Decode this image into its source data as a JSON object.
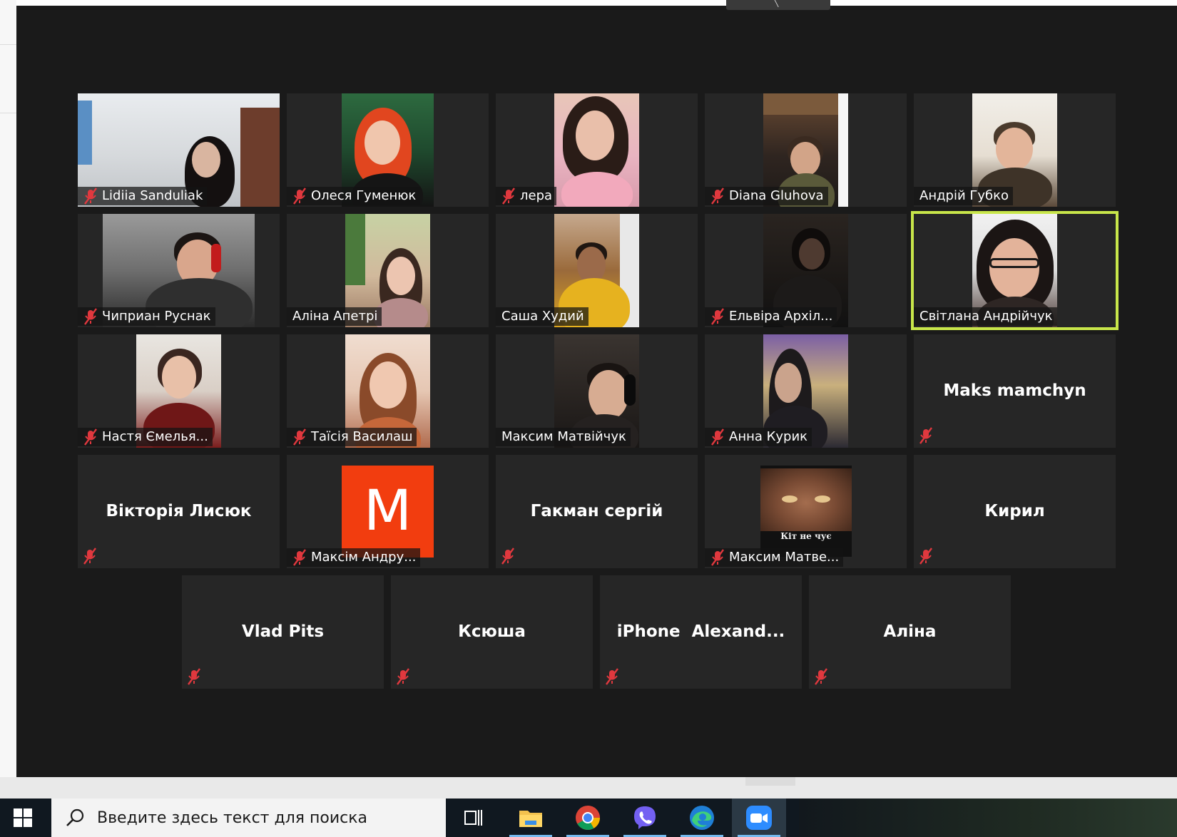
{
  "meeting": {
    "participants": [
      {
        "name": "Lidiia Sanduliak",
        "muted": true
      },
      {
        "name": "Олеся Гуменюк",
        "muted": true
      },
      {
        "name": "лера",
        "muted": true
      },
      {
        "name": "Diana Gluhova",
        "muted": true
      },
      {
        "name": "Андрій Губко",
        "muted": false
      },
      {
        "name": "Чиприан Руснак",
        "muted": true
      },
      {
        "name": "Аліна Апетрі",
        "muted": false
      },
      {
        "name": "Саша Худий",
        "muted": false
      },
      {
        "name": "Ельвіра Архіл...",
        "muted": true
      },
      {
        "name": "Світлана Андрійчук",
        "muted": false,
        "active_speaker": true
      },
      {
        "name": "Настя Ємелья...",
        "muted": true
      },
      {
        "name": "Таїсія Василаш",
        "muted": true
      },
      {
        "name": "Максим Матвійчук",
        "muted": false
      },
      {
        "name": "Анна Курик",
        "muted": true
      },
      {
        "name": "Maks mamchyn",
        "muted": true
      },
      {
        "name": "Вікторія Лисюк",
        "muted": true
      },
      {
        "name": "Максім Андру...",
        "muted": true,
        "avatar_letter": "M",
        "avatar_color": "#f23d0f"
      },
      {
        "name": "Гакман сергій",
        "muted": true
      },
      {
        "name": "Максим Матве...",
        "muted": true,
        "profile_caption": "Кіт не чує"
      },
      {
        "name": "Кирил",
        "muted": true
      },
      {
        "name": "Vlad Pits",
        "muted": true
      },
      {
        "name": "Ксюша",
        "muted": true
      },
      {
        "name": "iPhone  Alexand...",
        "muted": true
      },
      {
        "name": "Аліна",
        "muted": true
      }
    ],
    "colors": {
      "background": "#1a1a1a",
      "tile": "#262626",
      "active_speaker_border": "#c8e64a",
      "muted_icon": "#e0383e"
    }
  },
  "taskbar": {
    "search_placeholder": "Введите здесь текст для поиска",
    "icons": [
      {
        "name": "task-view-icon"
      },
      {
        "name": "file-explorer-icon"
      },
      {
        "name": "chrome-icon"
      },
      {
        "name": "viber-icon"
      },
      {
        "name": "edge-icon"
      },
      {
        "name": "zoom-icon",
        "active": true
      }
    ]
  }
}
